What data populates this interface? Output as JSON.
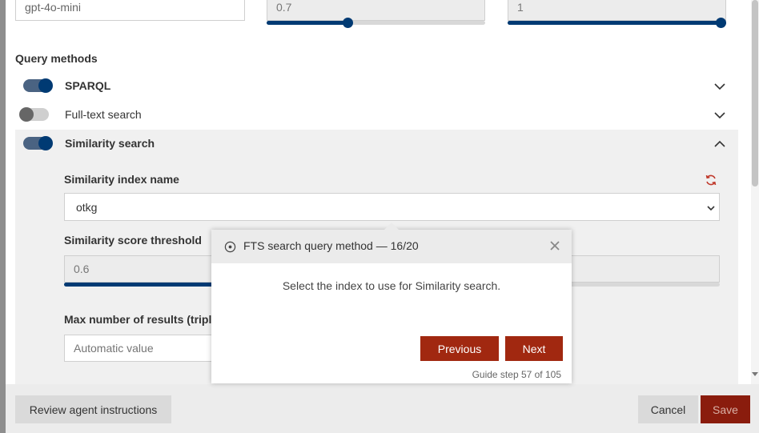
{
  "top_fields": {
    "model_value": "gpt-4o-mini",
    "temperature_value": "0.7",
    "temperature_level": 0.37,
    "top_p_value": "1",
    "top_p_level": 1.0
  },
  "query_methods": {
    "title": "Query methods",
    "items": [
      {
        "label": "SPARQL",
        "enabled": true,
        "expanded": false
      },
      {
        "label": "Full-text search",
        "enabled": false,
        "expanded": false
      },
      {
        "label": "Similarity search",
        "enabled": true,
        "expanded": true
      }
    ]
  },
  "similarity": {
    "index_label": "Similarity index name",
    "index_value": "otkg",
    "threshold_label": "Similarity score threshold",
    "threshold_value": "0.6",
    "threshold_level": 0.6,
    "max_results_label": "Max number of results (triple",
    "max_results_placeholder": "Automatic value"
  },
  "footer": {
    "review_label": "Review agent instructions",
    "cancel_label": "Cancel",
    "save_label": "Save"
  },
  "guide": {
    "title": "FTS search query method — 16/20",
    "body": "Select the index to use for Similarity search.",
    "previous_label": "Previous",
    "next_label": "Next",
    "step_text": "Guide step 57 of 105"
  },
  "icons": {
    "expand": "chevron-down-icon",
    "collapse": "chevron-up-icon",
    "refresh": "refresh-icon",
    "close": "close-icon",
    "target": "target-icon"
  },
  "colors": {
    "accent": "#003a73",
    "primary_button": "#a12810",
    "save_button": "#8a1c0d",
    "refresh_icon": "#c0392b"
  }
}
